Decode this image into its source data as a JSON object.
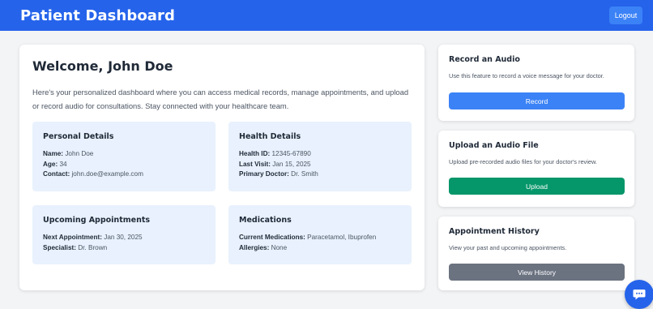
{
  "header": {
    "title": "Patient Dashboard",
    "logout_label": "Logout"
  },
  "main": {
    "welcome": "Welcome, John Doe",
    "intro": "Here's your personalized dashboard where you can access medical records, manage appointments, and upload or record audio for consultations. Stay connected with your healthcare team.",
    "personal": {
      "title": "Personal Details",
      "rows": [
        {
          "label": "Name:",
          "value": "John Doe"
        },
        {
          "label": "Age:",
          "value": "34"
        },
        {
          "label": "Contact:",
          "value": "john.doe@example.com"
        }
      ]
    },
    "health": {
      "title": "Health Details",
      "rows": [
        {
          "label": "Health ID:",
          "value": "12345-67890"
        },
        {
          "label": "Last Visit:",
          "value": "Jan 15, 2025"
        },
        {
          "label": "Primary Doctor:",
          "value": "Dr. Smith"
        }
      ]
    },
    "appointments": {
      "title": "Upcoming Appointments",
      "rows": [
        {
          "label": "Next Appointment:",
          "value": "Jan 30, 2025"
        },
        {
          "label": "Specialist:",
          "value": "Dr. Brown"
        }
      ]
    },
    "medications": {
      "title": "Medications",
      "rows": [
        {
          "label": "Current Medications:",
          "value": "Paracetamol, Ibuprofen"
        },
        {
          "label": "Allergies:",
          "value": "None"
        }
      ]
    }
  },
  "sidebar": {
    "record": {
      "title": "Record an Audio",
      "description": "Use this feature to record a voice message for your doctor.",
      "button": "Record",
      "button_color": "#3b82f6"
    },
    "upload": {
      "title": "Upload an Audio File",
      "description": "Upload pre-recorded audio files for your doctor's review.",
      "button": "Upload",
      "button_color": "#059669"
    },
    "history": {
      "title": "Appointment History",
      "description": "View your past and upcoming appointments.",
      "button": "View History",
      "button_color": "#6b7280"
    }
  },
  "chat": {
    "icon": "chat-bubble-icon"
  },
  "colors": {
    "brand": "#2563eb",
    "info_box_bg": "#e8f1fd"
  }
}
